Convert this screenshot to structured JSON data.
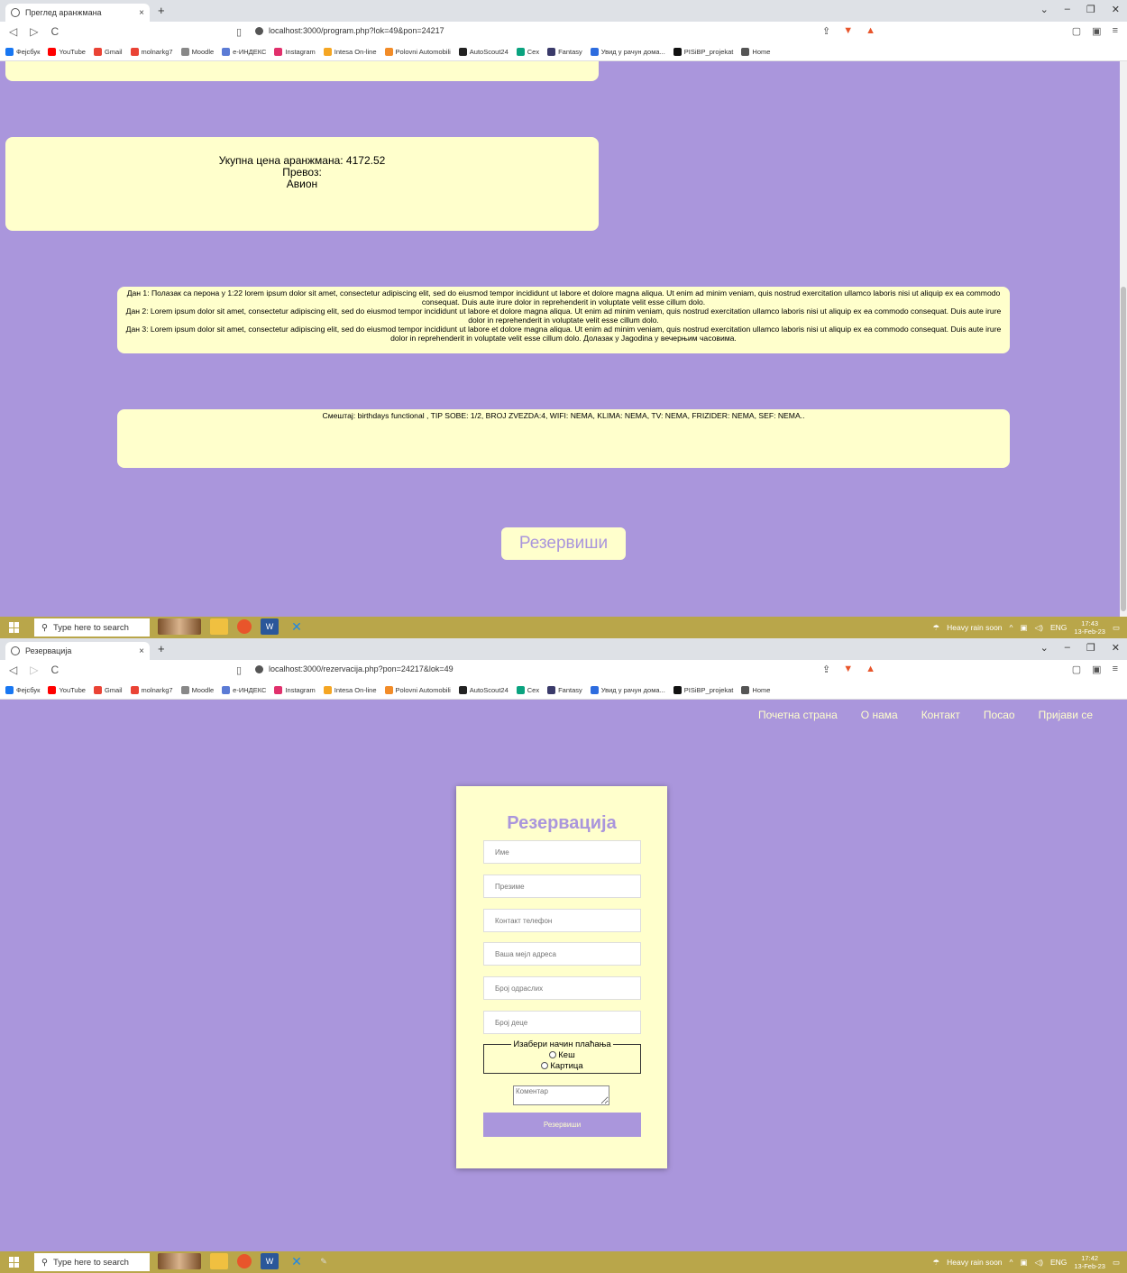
{
  "browser": {
    "bookmarks": [
      "Фејсбук",
      "YouTube",
      "Gmail",
      "molnarkg7",
      "Moodle",
      "e-ИНДЕКС",
      "Instagram",
      "Intesa On-line",
      "Polovni Automobili",
      "AutoScout24",
      "Cex",
      "Fantasy",
      "Увид у рачун дома...",
      "PISiBP_projekat",
      "Home"
    ],
    "tab_close": "×",
    "new_tab": "+"
  },
  "window1": {
    "tab_title": "Преглед аранжмана",
    "url": "localhost:3000/program.php?lok=49&pon=24217",
    "price_line": "Укупна цена аранжмана: 4172.52",
    "transport_label": "Превоз:",
    "transport_value": "Авион",
    "day1": "Дан 1: Полазак са перона у 1:22 lorem ipsum dolor sit amet, consectetur adipiscing elit, sed do eiusmod tempor incididunt ut labore et dolore magna aliqua. Ut enim ad minim veniam, quis nostrud exercitation ullamco laboris nisi ut aliquip ex ea commodo consequat. Duis aute irure dolor in reprehenderit in voluptate velit esse cillum dolo.",
    "day2": "Дан 2: Lorem ipsum dolor sit amet, consectetur adipiscing elit, sed do eiusmod tempor incididunt ut labore et dolore magna aliqua. Ut enim ad minim veniam, quis nostrud exercitation ullamco laboris nisi ut aliquip ex ea commodo consequat. Duis aute irure dolor in reprehenderit in voluptate velit esse cillum dolo.",
    "day3": "Дан 3: Lorem ipsum dolor sit amet, consectetur adipiscing elit, sed do eiusmod tempor incididunt ut labore et dolore magna aliqua. Ut enim ad minim veniam, quis nostrud exercitation ullamco laboris nisi ut aliquip ex ea commodo consequat. Duis aute irure dolor in reprehenderit in voluptate velit esse cillum dolo. Долазак у Jagodina у вечерњим часовима.",
    "lodging": "Смештај: birthdays functional , TIP SOBE: 1/2, BROJ ZVEZDA:4, WIFI: NEMA, KLIMA: NEMA, TV: NEMA, FRIZIDER: NEMA, SEF: NEMA..",
    "reserve_button": "Резервиши"
  },
  "window2": {
    "tab_title": "Резервација",
    "url": "localhost:3000/rezervacija.php?pon=24217&lok=49",
    "nav": [
      "Почетна страна",
      "О нама",
      "Контакт",
      "Посао",
      "Пријави се"
    ],
    "form_title": "Резервација",
    "fields": {
      "first_name": "Име",
      "last_name": "Презиме",
      "phone": "Контакт телефон",
      "email": "Ваша мејл адреса",
      "adults": "Број одраслих",
      "children": "Број деце"
    },
    "payment_legend": "Изабери начин плаћања",
    "payment_options": [
      "Кеш",
      "Картица"
    ],
    "comment_placeholder": "Коментар",
    "submit_label": "Резервиши"
  },
  "taskbar1": {
    "search": "Type here to search",
    "weather": "Heavy rain soon",
    "lang": "ENG",
    "time": "17:43",
    "date": "13-Feb-23"
  },
  "taskbar2": {
    "search": "Type here to search",
    "weather": "Heavy rain soon",
    "lang": "ENG",
    "time": "17:42",
    "date": "13-Feb-23"
  },
  "colors": {
    "page_bg": "#aa96dc",
    "card_bg": "#ffffcc",
    "taskbar": "#b9a64a"
  },
  "icons": [
    "globe-icon",
    "back-icon",
    "forward-icon",
    "reload-icon",
    "bookmark-icon",
    "info-icon",
    "share-icon",
    "brave-shield-icon",
    "rewards-icon",
    "sidebar-icon",
    "wallet-icon",
    "menu-icon",
    "windows-start-icon",
    "search-icon"
  ]
}
